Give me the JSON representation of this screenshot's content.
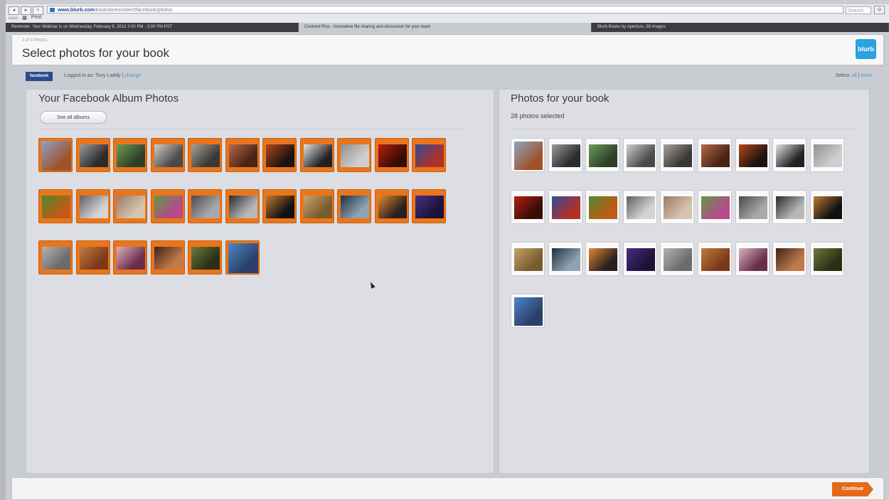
{
  "browser": {
    "url_domain": "www.blurb.com",
    "url_path": "/bookstores/select/facebook/photos",
    "search_placeholder": "Search",
    "bookmark_print": "Print",
    "tabs": [
      "Reminder: Your Webinar is on Wednesday, February 8, 2012 2:00 PM - 3:00 PM PST",
      "Connect Plus - Innovative file sharing and discussion for your team",
      "Blurb Books by Aperture, 28 images"
    ]
  },
  "header": {
    "step": "2 of 3 Photos",
    "title": "Select photos for your book",
    "logo": "blurb"
  },
  "account": {
    "badge": "facebook",
    "logged_in": "Logged in as: Tony Laddy",
    "separator": "|",
    "change": "change",
    "select_label": "Select:",
    "select_all": "all",
    "select_none": "none"
  },
  "left_panel": {
    "title": "Your Facebook Album Photos",
    "see_all_albums": "See all albums"
  },
  "right_panel": {
    "title": "Photos for your book",
    "selected_count": "28 photos selected"
  },
  "footer": {
    "continue_label": "Continue"
  },
  "left_photos": [
    {
      "name": "figure-blue",
      "colors": [
        "#8aa6c8",
        "#a0522d"
      ]
    },
    {
      "name": "bw-machine",
      "colors": [
        "#9b9b9b",
        "#2b2b2b"
      ]
    },
    {
      "name": "green-leaf",
      "colors": [
        "#6b9c55",
        "#2f3f2a"
      ]
    },
    {
      "name": "silver-device",
      "colors": [
        "#cfcfcf",
        "#4a4a4a"
      ]
    },
    {
      "name": "dark-texture",
      "colors": [
        "#a7a29a",
        "#3a3835"
      ]
    },
    {
      "name": "copper-pattern",
      "colors": [
        "#b7684a",
        "#4a2416"
      ]
    },
    {
      "name": "fire-dark",
      "colors": [
        "#b3471b",
        "#1d130f"
      ]
    },
    {
      "name": "lamp-white",
      "colors": [
        "#e3e3e3",
        "#222222"
      ]
    },
    {
      "name": "bw-gears",
      "colors": [
        "#8f8f8f",
        "#cfcfcf"
      ]
    },
    {
      "name": "red-bowl",
      "colors": [
        "#b31f10",
        "#3a0c06"
      ]
    },
    {
      "name": "blue-car",
      "colors": [
        "#2d4d9a",
        "#b0302a"
      ]
    },
    {
      "name": "green-flower",
      "colors": [
        "#4a8a2f",
        "#c15a16"
      ]
    },
    {
      "name": "bw-lines",
      "colors": [
        "#5f5f5f",
        "#d4d4d4"
      ]
    },
    {
      "name": "hand-crafts",
      "colors": [
        "#9a7b63",
        "#d6c3b0"
      ]
    },
    {
      "name": "toy-colorful",
      "colors": [
        "#5f9a46",
        "#b64a8a"
      ]
    },
    {
      "name": "bw-portrait",
      "colors": [
        "#4a4a4a",
        "#a9a9a9"
      ]
    },
    {
      "name": "dark-machine",
      "colors": [
        "#2a2a2a",
        "#b8b8b8"
      ]
    },
    {
      "name": "fish-dark",
      "colors": [
        "#c07a33",
        "#111111"
      ]
    },
    {
      "name": "wood-grain",
      "colors": [
        "#c9a46a",
        "#7a5a2f"
      ]
    },
    {
      "name": "night-river",
      "colors": [
        "#1f2e3e",
        "#8fa3b3"
      ]
    },
    {
      "name": "sunset",
      "colors": [
        "#e18a2f",
        "#2a1f20"
      ]
    },
    {
      "name": "purple-sky",
      "colors": [
        "#4a2e85",
        "#1c1238"
      ]
    },
    {
      "name": "grey-rocks",
      "colors": [
        "#b3b3b3",
        "#6b6b6b"
      ]
    },
    {
      "name": "copper-cups",
      "colors": [
        "#c57b3d",
        "#7a3a1a"
      ]
    },
    {
      "name": "pink-figures",
      "colors": [
        "#d9b3c0",
        "#6a2d4a"
      ]
    },
    {
      "name": "bird-dark",
      "colors": [
        "#3a2418",
        "#c07a4a"
      ]
    },
    {
      "name": "green-field",
      "colors": [
        "#6e7a3a",
        "#2a3015"
      ]
    },
    {
      "name": "robot-sky",
      "colors": [
        "#4f86c6",
        "#2b3f6a"
      ]
    }
  ],
  "book_photos": [
    {
      "name": "figure-blue",
      "colors": [
        "#8aa6c8",
        "#a0522d"
      ]
    },
    {
      "name": "bw-machine",
      "colors": [
        "#9b9b9b",
        "#2b2b2b"
      ]
    },
    {
      "name": "green-leaf",
      "colors": [
        "#6b9c55",
        "#2f3f2a"
      ]
    },
    {
      "name": "silver-device",
      "colors": [
        "#cfcfcf",
        "#4a4a4a"
      ]
    },
    {
      "name": "dark-texture",
      "colors": [
        "#a7a29a",
        "#3a3835"
      ]
    },
    {
      "name": "copper-pattern",
      "colors": [
        "#b7684a",
        "#4a2416"
      ]
    },
    {
      "name": "fire-dark",
      "colors": [
        "#b3471b",
        "#1d130f"
      ]
    },
    {
      "name": "lamp-white",
      "colors": [
        "#e3e3e3",
        "#222222"
      ]
    },
    {
      "name": "bw-gears",
      "colors": [
        "#8f8f8f",
        "#cfcfcf"
      ]
    },
    {
      "name": "red-bowl",
      "colors": [
        "#b31f10",
        "#3a0c06"
      ]
    },
    {
      "name": "blue-car",
      "colors": [
        "#2d4d9a",
        "#b0302a"
      ]
    },
    {
      "name": "green-flower",
      "colors": [
        "#4a8a2f",
        "#c15a16"
      ]
    },
    {
      "name": "bw-lines",
      "colors": [
        "#5f5f5f",
        "#d4d4d4"
      ]
    },
    {
      "name": "hand-crafts",
      "colors": [
        "#9a7b63",
        "#d6c3b0"
      ]
    },
    {
      "name": "toy-colorful",
      "colors": [
        "#5f9a46",
        "#b64a8a"
      ]
    },
    {
      "name": "bw-portrait",
      "colors": [
        "#4a4a4a",
        "#a9a9a9"
      ]
    },
    {
      "name": "dark-machine",
      "colors": [
        "#2a2a2a",
        "#b8b8b8"
      ]
    },
    {
      "name": "fish-dark",
      "colors": [
        "#c07a33",
        "#111111"
      ]
    },
    {
      "name": "wood-grain",
      "colors": [
        "#c9a46a",
        "#7a5a2f"
      ]
    },
    {
      "name": "night-river",
      "colors": [
        "#1f2e3e",
        "#8fa3b3"
      ]
    },
    {
      "name": "sunset",
      "colors": [
        "#e18a2f",
        "#2a1f20"
      ]
    },
    {
      "name": "purple-sky",
      "colors": [
        "#4a2e85",
        "#1c1238"
      ]
    },
    {
      "name": "grey-rocks",
      "colors": [
        "#b3b3b3",
        "#6b6b6b"
      ]
    },
    {
      "name": "copper-cups",
      "colors": [
        "#c57b3d",
        "#7a3a1a"
      ]
    },
    {
      "name": "pink-figures",
      "colors": [
        "#d9b3c0",
        "#6a2d4a"
      ]
    },
    {
      "name": "bird-dark",
      "colors": [
        "#3a2418",
        "#c07a4a"
      ]
    },
    {
      "name": "green-field",
      "colors": [
        "#6e7a3a",
        "#2a3015"
      ]
    },
    {
      "name": "robot-sky",
      "colors": [
        "#4f86c6",
        "#2b3f6a"
      ]
    }
  ],
  "colors": {
    "accent_orange": "#e9751c",
    "link_blue": "#3a9bd3",
    "facebook_blue": "#2b4a8b",
    "blurb_blue": "#2aa3de"
  }
}
